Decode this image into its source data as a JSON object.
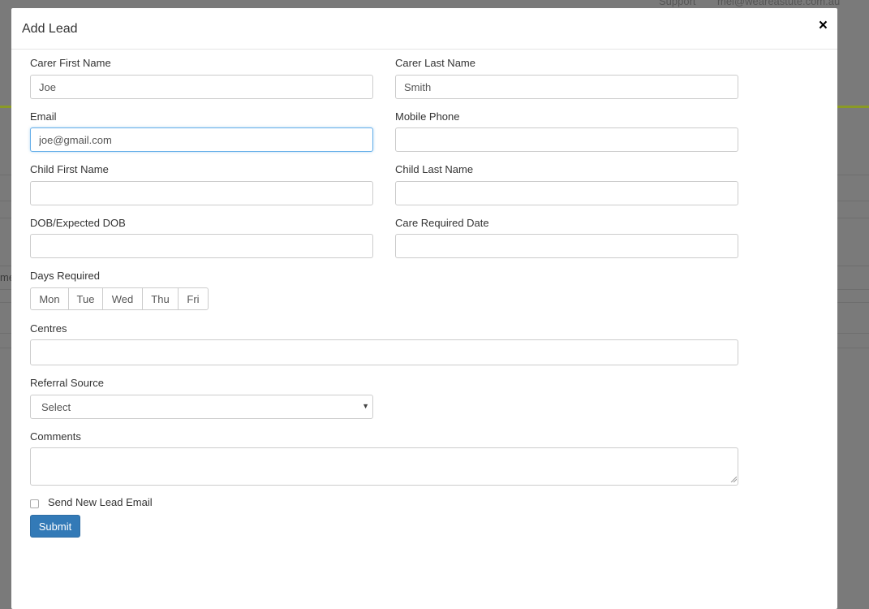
{
  "background": {
    "nav_support": "Support",
    "nav_user": "mel@weareastute.com.au",
    "fragment": "me"
  },
  "modal": {
    "title": "Add Lead",
    "close_symbol": "×"
  },
  "form": {
    "carer_first_name": {
      "label": "Carer First Name",
      "value": "Joe"
    },
    "carer_last_name": {
      "label": "Carer Last Name",
      "value": "Smith"
    },
    "email": {
      "label": "Email",
      "value": "joe@gmail.com"
    },
    "mobile_phone": {
      "label": "Mobile Phone",
      "value": ""
    },
    "child_first_name": {
      "label": "Child First Name",
      "value": ""
    },
    "child_last_name": {
      "label": "Child Last Name",
      "value": ""
    },
    "dob": {
      "label": "DOB/Expected DOB",
      "value": ""
    },
    "care_required_date": {
      "label": "Care Required Date",
      "value": ""
    },
    "days_required": {
      "label": "Days Required",
      "days": [
        "Mon",
        "Tue",
        "Wed",
        "Thu",
        "Fri"
      ]
    },
    "centres": {
      "label": "Centres",
      "value": ""
    },
    "referral_source": {
      "label": "Referral Source",
      "selected": "Select"
    },
    "comments": {
      "label": "Comments",
      "value": ""
    },
    "send_email": {
      "label": "Send New Lead Email",
      "checked": false
    },
    "submit_label": "Submit"
  },
  "colors": {
    "primary": "#337ab7",
    "focus": "#66afe9",
    "accent_green": "#8a9a24"
  }
}
